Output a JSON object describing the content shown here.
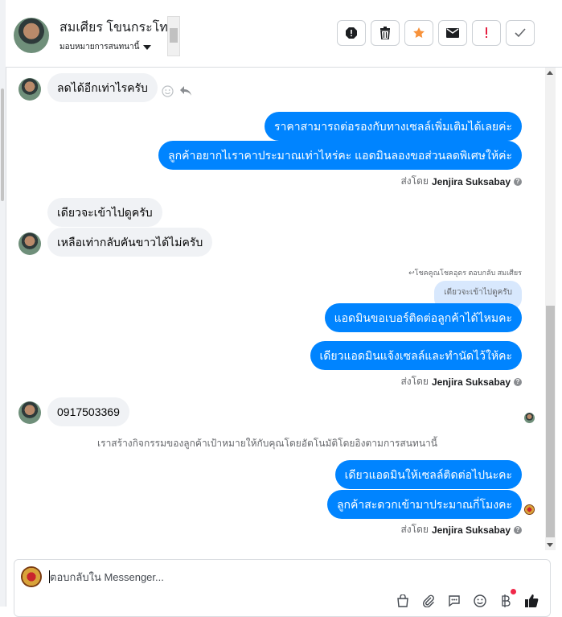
{
  "header": {
    "contact_name": "สมเศียร โขนกระโทก",
    "assign_label": "มอบหมายการสนทนานี้",
    "tools": [
      "spam-icon",
      "trash-icon",
      "star-icon",
      "mail-icon",
      "alert-icon",
      "check-icon"
    ],
    "colors": {
      "star": "#f7923b",
      "alert": "#e41e3f"
    }
  },
  "messages": {
    "m1": "ลดได้อีกเท่าไรครับ",
    "m2": "ราคาสามารถต่อรองกับทางเซลล์เพิ่มเติมได้เลยค่ะ",
    "m3": "ลูกค้าอยากไเราคาประมาณเท่าไหร่คะ แอดมินลองขอส่วนลดพิเศษให้ค่ะ",
    "sent1_prefix": "ส่งโดย",
    "sent1_name": "Jenjira Suksabay",
    "m4": "เดียวจะเข้าไปดูครับ",
    "m5": "เหลือเท่ากลับคันขาวได้ไม่ครับ",
    "reply_header": "↩︎โชคคูณโชคอุดร ตอบกลับ สมเศียร",
    "quoted": "เดียวจะเข้าไปดูครับ",
    "m6": "แอดมินขอเบอร์ติดต่อลูกค้าได้ไหมคะ",
    "m7": "เดียวแอดมินแจ้งเซลล์และทำนัดไว้ให้คะ",
    "sent2_prefix": "ส่งโดย",
    "sent2_name": "Jenjira Suksabay",
    "m8": "0917503369",
    "system": "เราสร้างกิจกรรมของลูกค้าเป้าหมายให้กับคุณโดยอัตโนมัติโดยอิงตามการสนทนานี้",
    "m9": "เดียวแอดมินให้เซลล์ติดต่อไปนะคะ",
    "m10": "ลูกค้าสะดวกเข้ามาประมาณกี่โมงคะ",
    "sent3_prefix": "ส่งโดย",
    "sent3_name": "Jenjira Suksabay"
  },
  "composer": {
    "placeholder": "ตอบกลับใน Messenger...",
    "tools": [
      "bag-icon",
      "attach-icon",
      "saved-reply-icon",
      "emoji-icon",
      "baht-icon",
      "like-icon"
    ]
  },
  "colors": {
    "outgoing": "#0084ff",
    "incoming": "#f0f2f5",
    "quoted": "#d8e8fd"
  }
}
